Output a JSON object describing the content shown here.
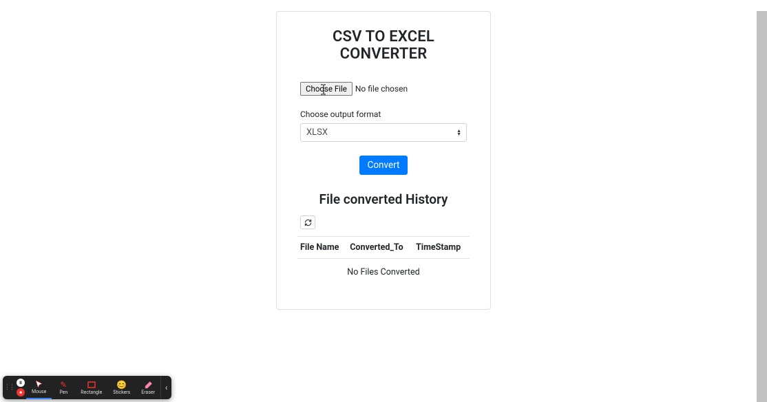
{
  "card": {
    "title": "CSV TO EXCEL CONVERTER",
    "file": {
      "choose_label": "Choose File",
      "no_file": "No file chosen"
    },
    "format": {
      "label": "Choose output format",
      "selected": "XLSX"
    },
    "convert_label": "Convert",
    "history": {
      "title": "File converted History",
      "columns": [
        "File Name",
        "Converted_To",
        "TimeStamp"
      ],
      "empty": "No Files Converted"
    }
  },
  "toolbar": {
    "items": [
      {
        "label": "Mouse"
      },
      {
        "label": "Pen"
      },
      {
        "label": "Rectangle"
      },
      {
        "label": "Stickers"
      },
      {
        "label": "Eraser"
      }
    ]
  }
}
